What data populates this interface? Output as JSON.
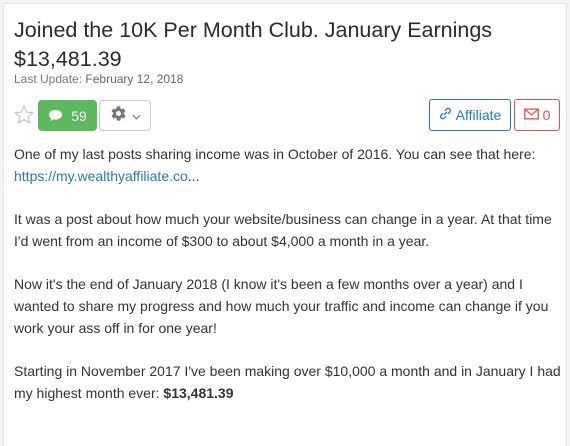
{
  "post": {
    "title": "Joined the 10K Per Month Club. January Earnings $13,481.39",
    "last_update_label": "Last Update:",
    "last_update_date": "February 12, 2018"
  },
  "toolbar": {
    "comment_count": "59",
    "affiliate_label": "Affiliate",
    "mail_count": "0"
  },
  "body": {
    "p1_text": "One of my last posts sharing income was in October of 2016. You can see that here:",
    "p1_link": "https://my.wealthyaffiliate.co",
    "p1_ellipsis": "...",
    "p2": "It was a post about how much your website/business can change in a year. At that time I'd went from an income of $300 to about $4,000 a month in a year.",
    "p3": "Now it's the end of January 2018 (I know it's been a few months over a year) and I wanted to share my progress and how much your traffic and income can change if you work your ass off in for one year!",
    "p4_text": "Starting in November 2017 I've been making over $10,000 a month and in January I had my highest month ever:",
    "p4_strong": "$13,481.39"
  },
  "colors": {
    "green_button": "#5cb85c",
    "affiliate_blue": "#2a7ab0",
    "mail_red": "#d9534f"
  },
  "icons": {
    "favorite": "star-icon",
    "comments": "comment-bubble-icon",
    "settings": "gear-icon",
    "dropdown": "chevron-down-icon",
    "affiliate": "link-icon",
    "mail": "envelope-icon"
  }
}
